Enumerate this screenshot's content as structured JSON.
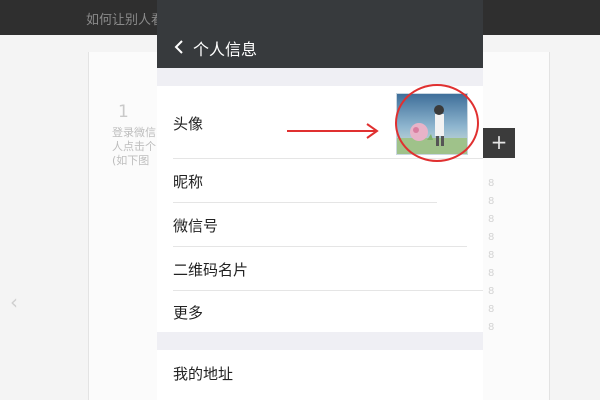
{
  "background": {
    "topbar_title": "如何让别人看",
    "step_number": "1",
    "step_text": "登录微信人点击个(如下图",
    "plus_button": "+",
    "right_marks": [
      "8",
      "8",
      "8",
      "8",
      "8",
      "8",
      "8",
      "8",
      "8"
    ]
  },
  "phone": {
    "header": {
      "title": "个人信息",
      "back_icon": "chevron-left-icon"
    },
    "profile_items": [
      {
        "label": "头像"
      },
      {
        "label": "昵称"
      },
      {
        "label": "微信号"
      },
      {
        "label": "二维码名片"
      },
      {
        "label": "更多"
      }
    ],
    "address_item": {
      "label": "我的地址"
    }
  },
  "annotation": {
    "color": "#e03030"
  },
  "colors": {
    "header_bg": "#373a3d",
    "page_bg": "#efeff4",
    "list_bg": "#ffffff"
  }
}
